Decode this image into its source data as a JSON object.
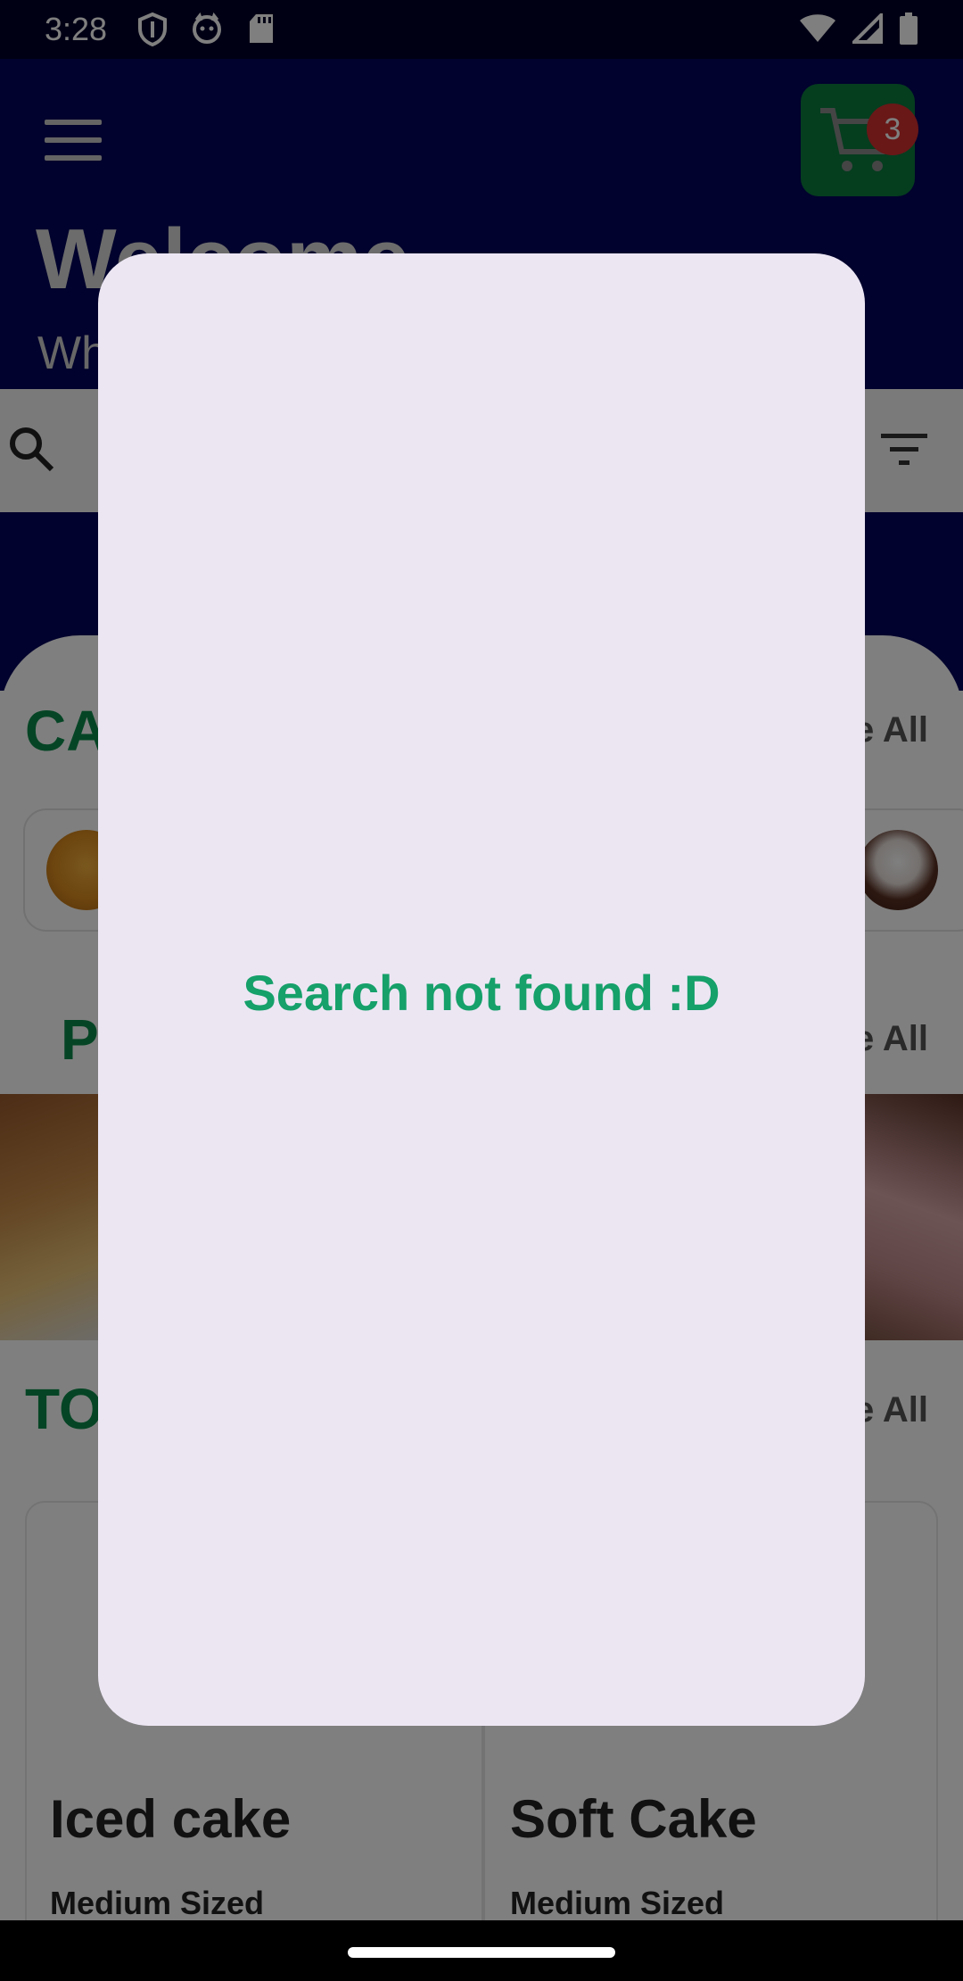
{
  "status_bar": {
    "time": "3:28",
    "left_icons": [
      "shield-icon",
      "cat-icon",
      "sd-card-icon"
    ],
    "right_icons": [
      "wifi-icon",
      "signal-icon",
      "battery-icon"
    ]
  },
  "header": {
    "title": "Welcome",
    "subtitle": "Wh",
    "cart_count": "3",
    "colors": {
      "background": "#03055a",
      "cart": "#0b7a3e",
      "badge": "#d32f2f"
    }
  },
  "search": {
    "icon": "search-icon",
    "filter_icon": "filter-icon"
  },
  "sections": {
    "categories_title": "CA",
    "categories_see_all": "e All",
    "popular_title": "P",
    "popular_see_all": "e All",
    "top_title": "TO",
    "top_see_all": "e All"
  },
  "products": [
    {
      "name": "Iced cake",
      "size": "Medium Sized"
    },
    {
      "name": "Soft Cake",
      "size": "Medium Sized"
    }
  ],
  "dialog": {
    "message": "Search not found :D",
    "colors": {
      "background": "#ece6f3",
      "text": "#16a06a"
    }
  }
}
